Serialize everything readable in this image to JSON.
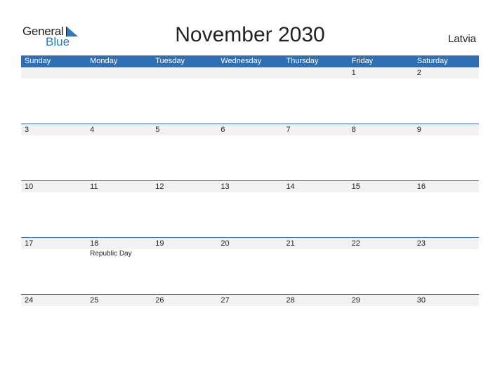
{
  "logo": {
    "text_general": "General",
    "text_blue": "Blue"
  },
  "title": "November 2030",
  "country": "Latvia",
  "colors": {
    "accent": "#2e6fb5",
    "band": "#f2f2f2",
    "logo_blue": "#2a7bc4"
  },
  "weekdays": [
    "Sunday",
    "Monday",
    "Tuesday",
    "Wednesday",
    "Thursday",
    "Friday",
    "Saturday"
  ],
  "weeks": [
    {
      "days": [
        {
          "num": "",
          "event": ""
        },
        {
          "num": "",
          "event": ""
        },
        {
          "num": "",
          "event": ""
        },
        {
          "num": "",
          "event": ""
        },
        {
          "num": "",
          "event": ""
        },
        {
          "num": "1",
          "event": ""
        },
        {
          "num": "2",
          "event": ""
        }
      ]
    },
    {
      "days": [
        {
          "num": "3",
          "event": ""
        },
        {
          "num": "4",
          "event": ""
        },
        {
          "num": "5",
          "event": ""
        },
        {
          "num": "6",
          "event": ""
        },
        {
          "num": "7",
          "event": ""
        },
        {
          "num": "8",
          "event": ""
        },
        {
          "num": "9",
          "event": ""
        }
      ]
    },
    {
      "days": [
        {
          "num": "10",
          "event": ""
        },
        {
          "num": "11",
          "event": ""
        },
        {
          "num": "12",
          "event": ""
        },
        {
          "num": "13",
          "event": ""
        },
        {
          "num": "14",
          "event": ""
        },
        {
          "num": "15",
          "event": ""
        },
        {
          "num": "16",
          "event": ""
        }
      ]
    },
    {
      "days": [
        {
          "num": "17",
          "event": ""
        },
        {
          "num": "18",
          "event": "Republic Day"
        },
        {
          "num": "19",
          "event": ""
        },
        {
          "num": "20",
          "event": ""
        },
        {
          "num": "21",
          "event": ""
        },
        {
          "num": "22",
          "event": ""
        },
        {
          "num": "23",
          "event": ""
        }
      ]
    },
    {
      "days": [
        {
          "num": "24",
          "event": ""
        },
        {
          "num": "25",
          "event": ""
        },
        {
          "num": "26",
          "event": ""
        },
        {
          "num": "27",
          "event": ""
        },
        {
          "num": "28",
          "event": ""
        },
        {
          "num": "29",
          "event": ""
        },
        {
          "num": "30",
          "event": ""
        }
      ]
    }
  ]
}
